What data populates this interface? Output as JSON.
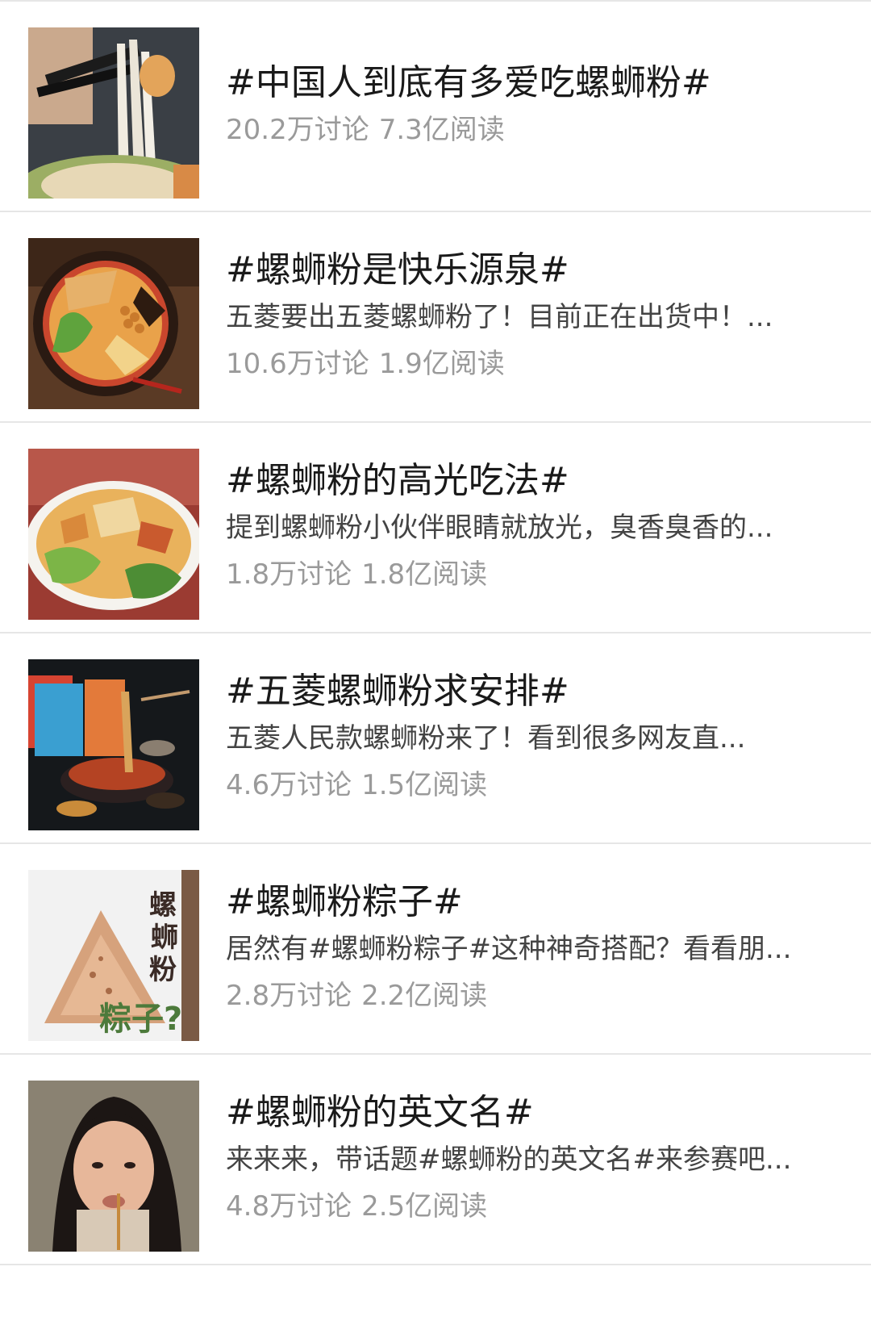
{
  "topics": [
    {
      "title": "#中国人到底有多爱吃螺蛳粉#",
      "desc": "",
      "discussions": "20.2万讨论",
      "reads": "7.3亿阅读",
      "thumb_icon": "noodles-chopsticks-photo"
    },
    {
      "title": "#螺蛳粉是快乐源泉#",
      "desc": "五菱要出五菱螺蛳粉了！目前正在出货中！...",
      "discussions": "10.6万讨论",
      "reads": "1.9亿阅读",
      "thumb_icon": "noodle-bowl-photo"
    },
    {
      "title": "#螺蛳粉的高光吃法#",
      "desc": "提到螺蛳粉小伙伴眼睛就放光，臭香臭香的...",
      "discussions": "1.8万讨论",
      "reads": "1.8亿阅读",
      "thumb_icon": "noodle-plate-photo"
    },
    {
      "title": "#五菱螺蛳粉求安排#",
      "desc": "五菱人民款螺蛳粉来了！看到很多网友直...",
      "discussions": "4.6万讨论",
      "reads": "1.5亿阅读",
      "thumb_icon": "product-package-photo"
    },
    {
      "title": "#螺蛳粉粽子#",
      "desc": "居然有#螺蛳粉粽子#这种神奇搭配？看看朋...",
      "discussions": "2.8万讨论",
      "reads": "2.2亿阅读",
      "thumb_icon": "zongzi-photo",
      "thumb_text": [
        "螺",
        "蛳",
        "粉",
        "粽子?"
      ]
    },
    {
      "title": "#螺蛳粉的英文名#",
      "desc": "来来来，带话题#螺蛳粉的英文名#来参赛吧...",
      "discussions": "4.8万讨论",
      "reads": "2.5亿阅读",
      "thumb_icon": "girl-eating-photo"
    }
  ],
  "colors": {
    "title": "#1a1a1a",
    "desc": "#444444",
    "stats": "#9a9a9a",
    "divider": "#e6e6e6"
  }
}
